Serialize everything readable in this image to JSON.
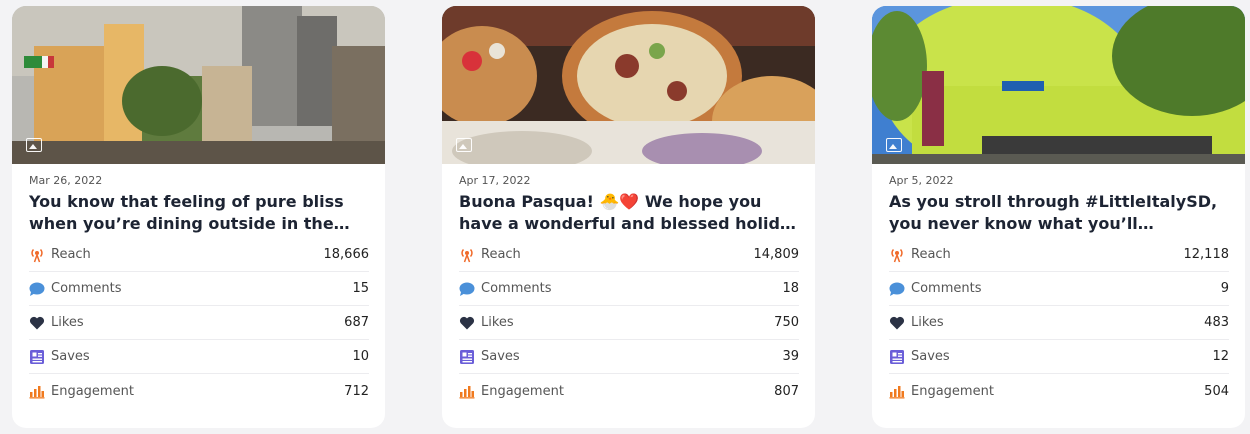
{
  "icons": {
    "reach": "broadcast-icon",
    "comments": "speech-bubble-icon",
    "likes": "heart-icon",
    "saves": "saves-icon",
    "engagement": "bar-chart-icon"
  },
  "colors": {
    "reach": "#f06a2a",
    "comments": "#4a90d9",
    "likes": "#2b3245",
    "saves": "#6a5ed8",
    "engagement": "#f07a1f"
  },
  "posts": [
    {
      "date": "Mar 26, 2022",
      "caption": "You know that feeling of pure bliss when you’re dining outside in the…",
      "metrics": [
        {
          "label": "Reach",
          "value": "18,666"
        },
        {
          "label": "Comments",
          "value": "15"
        },
        {
          "label": "Likes",
          "value": "687"
        },
        {
          "label": "Saves",
          "value": "10"
        },
        {
          "label": "Engagement",
          "value": "712"
        }
      ]
    },
    {
      "date": "Apr 17, 2022",
      "caption": "Buona Pasqua! 🐣❤️  We hope you have a wonderful and blessed holid…",
      "metrics": [
        {
          "label": "Reach",
          "value": "14,809"
        },
        {
          "label": "Comments",
          "value": "18"
        },
        {
          "label": "Likes",
          "value": "750"
        },
        {
          "label": "Saves",
          "value": "39"
        },
        {
          "label": "Engagement",
          "value": "807"
        }
      ]
    },
    {
      "date": "Apr 5, 2022",
      "caption": "As you stroll through #LittleItalySD, you never know what you’ll discover.…",
      "metrics": [
        {
          "label": "Reach",
          "value": "12,118"
        },
        {
          "label": "Comments",
          "value": "9"
        },
        {
          "label": "Likes",
          "value": "483"
        },
        {
          "label": "Saves",
          "value": "12"
        },
        {
          "label": "Engagement",
          "value": "504"
        }
      ]
    }
  ]
}
